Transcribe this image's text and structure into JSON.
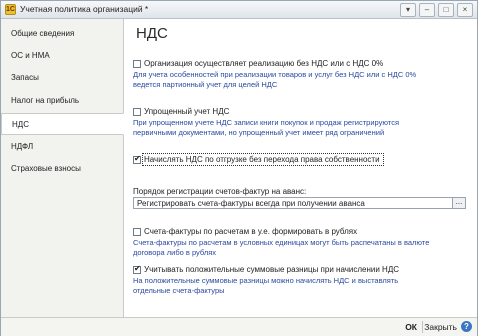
{
  "window": {
    "title": "Учетная политика организаций *",
    "app_icon": "1С",
    "buttons": {
      "menu": "▾",
      "minimize": "–",
      "maximize": "□",
      "close": "×"
    }
  },
  "sidebar": {
    "items": [
      {
        "label": "Общие сведения"
      },
      {
        "label": "ОС и НМА"
      },
      {
        "label": "Запасы"
      },
      {
        "label": "Налог на прибыль"
      },
      {
        "label": "НДС",
        "active": true
      },
      {
        "label": "НДФЛ"
      },
      {
        "label": "Страховые взносы"
      }
    ]
  },
  "main": {
    "title": "НДС",
    "options": [
      {
        "label": "Организация осуществляет реализацию без НДС или с НДС 0%",
        "checked": false,
        "hint": "Для учета особенностей при реализации товаров и услуг без НДС или с НДС 0% ведется партионный учет для целей НДС"
      },
      {
        "label": "Упрощенный учет НДС",
        "checked": false,
        "hint": "При упрощенном учете НДС записи книги покупок и продаж регистрируются первичными документами, но упрощенный учет имеет ряд ограничений"
      },
      {
        "label": "Начислять НДС по отгрузке без перехода права собственности",
        "checked": true
      },
      {
        "label": "Счета-фактуры по расчетам в у.е. формировать в рублях",
        "checked": false,
        "hint": "Счета-фактуры по расчетам в условных единицах могут быть распечатаны в валюте договора либо в рублях"
      },
      {
        "label": "Учитывать положительные суммовые разницы при начислении НДС",
        "checked": true,
        "hint": "На положительные суммовые разницы можно начислять НДС и выставлять отдельные счета-фактуры"
      }
    ],
    "invoice_order": {
      "label": "Порядок регистрации счетов-фактур на аванс:",
      "value": "Регистрировать счета-фактуры всегда при получении аванса",
      "button": "..."
    }
  },
  "footer": {
    "ok_label": "ОК",
    "close_label": "Закрыть",
    "help_label": "?"
  },
  "colors": {
    "hint": "#2a4aa0",
    "sidebar_bg": "#f2f2ee",
    "help": "#3a76c4"
  }
}
